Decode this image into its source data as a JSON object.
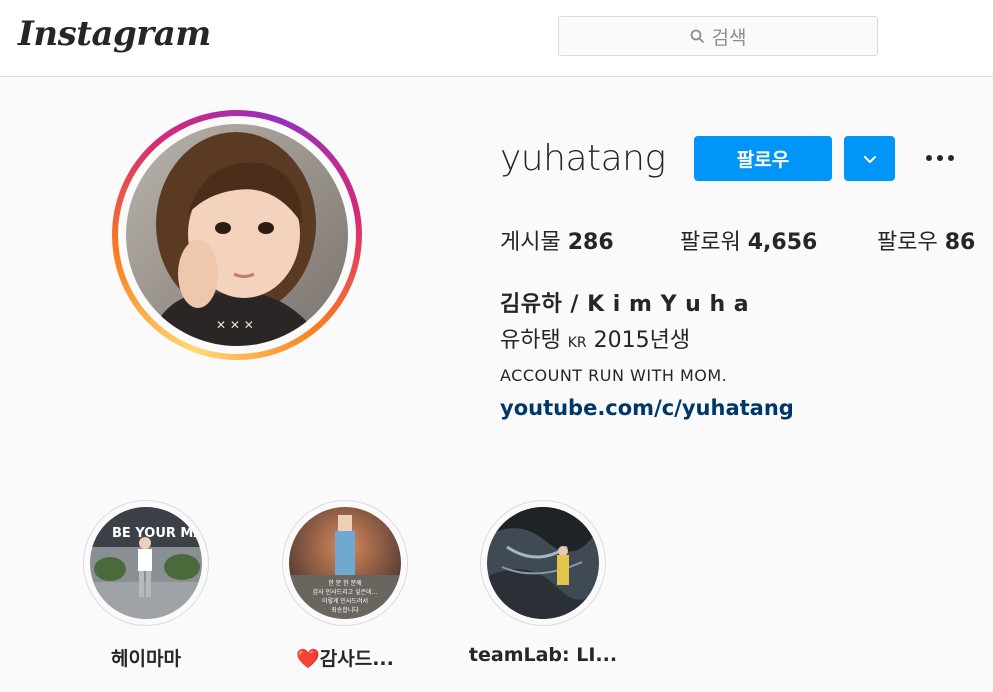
{
  "header": {
    "logo": "Instagram",
    "search_placeholder": "검색"
  },
  "profile": {
    "username": "yuhatang",
    "follow_label": "팔로우",
    "stats": [
      {
        "label": "게시물",
        "value": "286"
      },
      {
        "label": "팔로워",
        "value": "4,656"
      },
      {
        "label": "팔로우",
        "value": "86"
      }
    ],
    "full_name": "김유하 / K i m Y u h a",
    "bio_line1_main": "유하탱",
    "bio_line1_small": "KR",
    "bio_line1_end": "2015년생",
    "bio_line2": "ACCOUNT RUN WITH MOM.",
    "link": "youtube.com/c/yuhatang"
  },
  "highlights": [
    {
      "label": "헤이마마",
      "overlay_text": "BE YOUR MAN"
    },
    {
      "label": "❤️감사드...",
      "overlay_lines": [
        "한 분 한 분께",
        "감사 인사드리고 싶은데...",
        "이렇게 인사드려서",
        "죄송합니다"
      ]
    },
    {
      "label": "teamLab: LI..."
    }
  ],
  "colors": {
    "accent": "#0095f6",
    "link": "#00376b",
    "text": "#262626",
    "muted": "#8e8e8e",
    "border": "#dbdbdb"
  }
}
